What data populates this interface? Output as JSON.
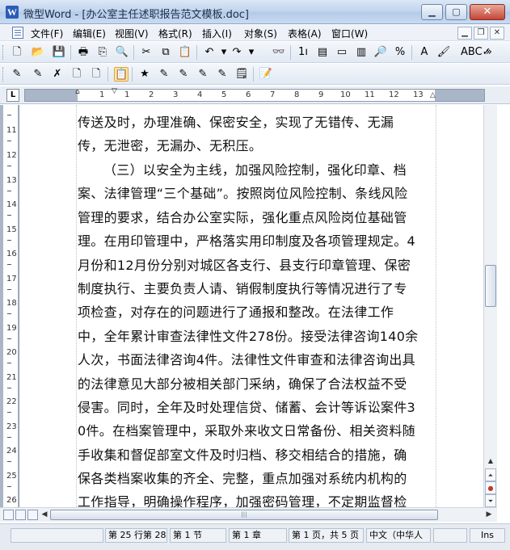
{
  "window": {
    "title": "微型Word - [办公室主任述职报告范文模板.doc]",
    "app_icon_letter": "W"
  },
  "menu": [
    "文件(F)",
    "编辑(E)",
    "视图(V)",
    "格式(R)",
    "插入(I)",
    "对象(S)",
    "表格(A)",
    "窗口(W)"
  ],
  "ruler": {
    "corner": "L",
    "numbers": [
      "1",
      "1",
      "2",
      "3",
      "4",
      "5",
      "6",
      "7",
      "8",
      "9",
      "10",
      "11",
      "12",
      "13",
      "14"
    ]
  },
  "vruler": {
    "numbers": [
      "11",
      "12",
      "13",
      "14",
      "15",
      "16",
      "17",
      "18",
      "19",
      "20",
      "21",
      "22",
      "23",
      "24",
      "25",
      "26"
    ]
  },
  "document": {
    "lines": [
      "传送及时，办理准确、保密安全，实现了无错传、无漏",
      "传，无泄密，无漏办、无积压。",
      "（三）以安全为主线，加强风险控制，强化印章、档",
      "案、法律管理“三个基础”。按照岗位风险控制、条线风险",
      "管理的要求，结合办公室实际，强化重点风险岗位基础管",
      "理。在用印管理中，严格落实用印制度及各项管理规定。4",
      "月份和12月份分别对城区各支行、县支行印章管理、保密",
      "制度执行、主要负责人请、销假制度执行等情况进行了专",
      "项检查，对存在的问题进行了通报和整改。在法律工作",
      "中，全年累计审查法律性文件278份。接受法律咨询140余",
      "人次，书面法律咨询4件。法律性文件审查和法律咨询出具",
      "的法律意见大部分被相关部门采纳，确保了合法权益不受",
      "侵害。同时，全年及时处理信贷、储蓄、会计等诉讼案件3",
      "0件。在档案管理中，采取外来收文日常备份、相关资料随",
      "手收集和督促部室文件及时归档、移交相结合的措施，确",
      "保各类档案收集的齐全、完整，重点加强对系统内机构的",
      "工作指导，明确操作程序，加强密码管理，不定期监督检"
    ]
  },
  "status": {
    "position": "第 25 行第 28",
    "section": "第 1 节",
    "chapter": "第 1 章",
    "page": "第 1 页，共 5 页",
    "language": "中文（中华人",
    "mode": "Ins"
  },
  "icons": {
    "tb1": [
      "new-icon",
      "open-icon",
      "save-icon",
      "print-icon",
      "pdf-icon",
      "print-preview-icon",
      "cut-icon",
      "copy-icon",
      "paste-icon",
      "undo-icon",
      "redo-icon",
      "find-icon",
      "page-number-icon",
      "insert-table-icon",
      "text-box-icon",
      "columns-icon",
      "zoom-icon",
      "special-chars-icon",
      "font-color-icon",
      "format-painter-icon",
      "spellcheck-icon",
      "more-icon"
    ],
    "tb2": [
      "highlight-icon",
      "edit-icon",
      "delete-icon",
      "page-setup-icon",
      "template-icon",
      "style-icon",
      "bookmark-icon",
      "track-changes-icon",
      "accept-change-icon",
      "reject-change-icon",
      "comment-icon",
      "review-icon"
    ]
  }
}
